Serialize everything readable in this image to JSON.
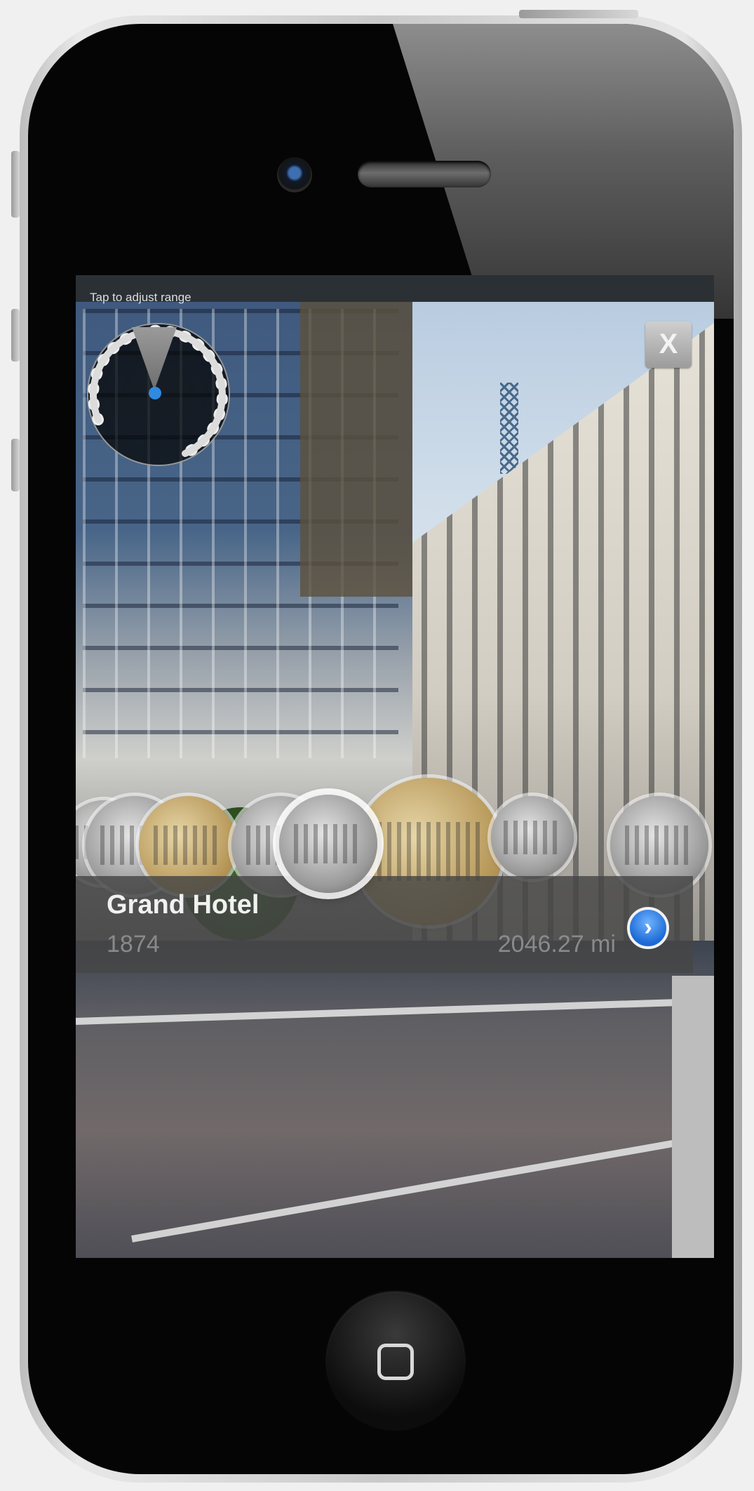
{
  "hud": {
    "range_hint": "Tap to adjust range",
    "close_label": "X"
  },
  "location": {
    "name": "Grand Hotel",
    "year": "1874",
    "distance": "2046.27 mi",
    "disclosure_glyph": "›"
  },
  "photo_bubbles": [
    {
      "tone": "bw"
    },
    {
      "tone": "bw"
    },
    {
      "tone": "sepia"
    },
    {
      "tone": "bw"
    },
    {
      "tone": "bw",
      "selected": true
    },
    {
      "tone": "sepia"
    },
    {
      "tone": "bw"
    },
    {
      "tone": "bw"
    }
  ],
  "colors": {
    "accent_blue": "#2f8ae0",
    "panel": "#464646"
  },
  "icons": {
    "close": "close-icon",
    "disclosure": "chevron-right-icon",
    "home": "home-icon",
    "radar": "radar-icon"
  }
}
